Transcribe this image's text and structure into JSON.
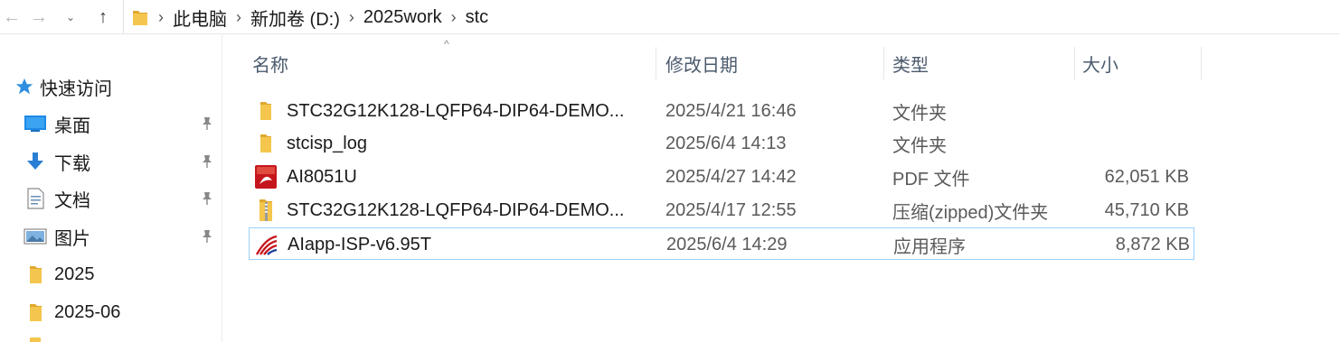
{
  "nav": {
    "back_glyph": "←",
    "forward_glyph": "→",
    "recent_glyph": "⌄",
    "up_glyph": "↑",
    "breadcrumbs": [
      "此电脑",
      "新加卷 (D:)",
      "2025work",
      "stc"
    ],
    "separator": "›"
  },
  "sidebar": {
    "quick_access": "快速访问",
    "items": [
      {
        "label": "桌面",
        "icon": "desktop-icon",
        "pinned": true
      },
      {
        "label": "下载",
        "icon": "download-icon",
        "pinned": true
      },
      {
        "label": "文档",
        "icon": "document-icon",
        "pinned": true
      },
      {
        "label": "图片",
        "icon": "pictures-icon",
        "pinned": true
      },
      {
        "label": "2025",
        "icon": "folder-icon",
        "pinned": false
      },
      {
        "label": "2025-06",
        "icon": "folder-icon",
        "pinned": false
      }
    ]
  },
  "columns": {
    "sort_indicator": "^",
    "name": "名称",
    "date": "修改日期",
    "type": "类型",
    "size": "大小"
  },
  "files": [
    {
      "icon": "folder-icon",
      "name": "STC32G12K128-LQFP64-DIP64-DEMO...",
      "date": "2025/4/21 16:46",
      "type": "文件夹",
      "size": ""
    },
    {
      "icon": "folder-icon",
      "name": "stcisp_log",
      "date": "2025/6/4 14:13",
      "type": "文件夹",
      "size": ""
    },
    {
      "icon": "pdf-icon",
      "name": "AI8051U",
      "date": "2025/4/27 14:42",
      "type": "PDF 文件",
      "size": "62,051 KB"
    },
    {
      "icon": "zip-folder-icon",
      "name": "STC32G12K128-LQFP64-DIP64-DEMO...",
      "date": "2025/4/17 12:55",
      "type": "压缩(zipped)文件夹",
      "size": "45,710 KB"
    },
    {
      "icon": "app-icon",
      "name": "AIapp-ISP-v6.95T",
      "date": "2025/6/4 14:29",
      "type": "应用程序",
      "size": "8,872 KB"
    }
  ],
  "colors": {
    "folder": "#f4c64d",
    "folder_dark": "#e0a82e",
    "selection_border": "#99d1ff",
    "quick_access_star": "#2f8ee0",
    "pdf_red": "#c5161d"
  }
}
